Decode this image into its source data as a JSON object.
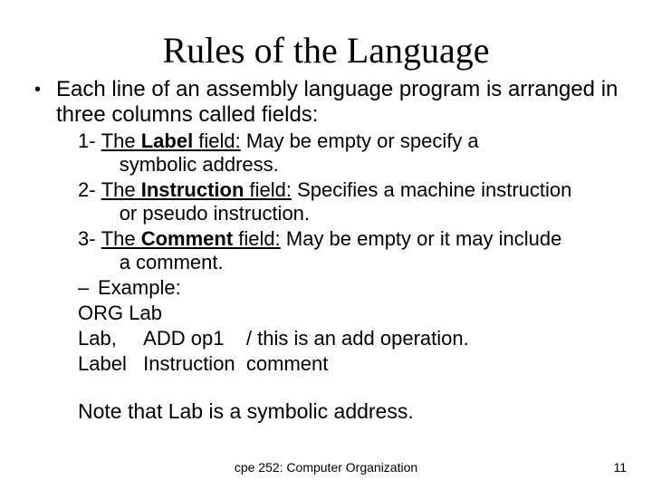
{
  "title": "Rules of the Language",
  "main_bullet": "Each line of an assembly language program is arranged in three columns called fields:",
  "items": {
    "i1": {
      "num": "1- ",
      "label_u": "The ",
      "label_bu": "Label",
      "label_u2": " field:",
      "rest": "  May be empty or specify a",
      "wrap": "symbolic address."
    },
    "i2": {
      "num": "2- ",
      "label_u": "The ",
      "label_bu": "Instruction",
      "label_u2": " field:",
      "rest": " Specifies a machine instruction",
      "wrap": "or pseudo instruction."
    },
    "i3": {
      "num": "3- ",
      "label_u": "The ",
      "label_bu": "Comment",
      "label_u2": " field:",
      "rest": " May be empty or it may include",
      "wrap": "a comment."
    }
  },
  "example_label": "Example:",
  "code": {
    "l1": "ORG Lab",
    "l2": "Lab,     ADD op1    / this is an add operation.",
    "l3": "Label   Instruction  comment"
  },
  "note": "Note that Lab is a symbolic address.",
  "footer_center": "cpe 252: Computer Organization",
  "footer_page": "11"
}
